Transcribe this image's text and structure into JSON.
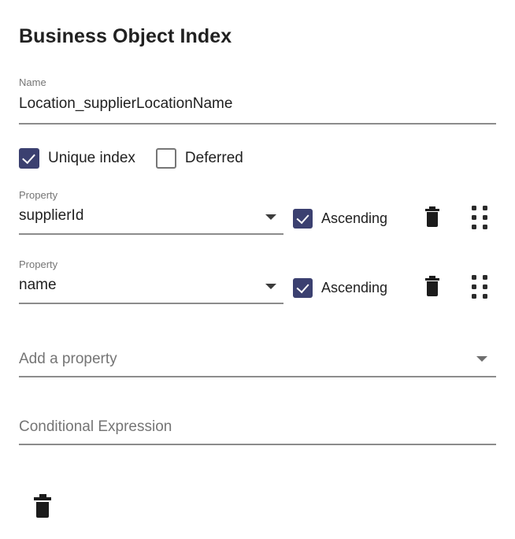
{
  "page": {
    "title": "Business Object Index"
  },
  "name_field": {
    "label": "Name",
    "value": "Location_supplierLocationName"
  },
  "options": {
    "unique_index": {
      "label": "Unique index",
      "checked": true
    },
    "deferred": {
      "label": "Deferred",
      "checked": false
    }
  },
  "properties": [
    {
      "label": "Property",
      "value": "supplierId",
      "direction_label": "Ascending",
      "direction_checked": true,
      "delete_icon": "trash-icon",
      "drag_icon": "drag-handle-icon"
    },
    {
      "label": "Property",
      "value": "name",
      "direction_label": "Ascending",
      "direction_checked": true,
      "delete_icon": "trash-icon",
      "drag_icon": "drag-handle-icon"
    }
  ],
  "add_property": {
    "placeholder": "Add a property",
    "caret_icon": "chevron-down-icon"
  },
  "conditional_expression": {
    "placeholder": "Conditional Expression",
    "value": ""
  },
  "footer": {
    "delete_icon": "trash-icon"
  },
  "colors": {
    "accent": "#3b4070",
    "text_primary": "#212121",
    "text_secondary": "#757575",
    "underline": "#8c8c8c",
    "icon_dark": "#1b1b1b"
  }
}
